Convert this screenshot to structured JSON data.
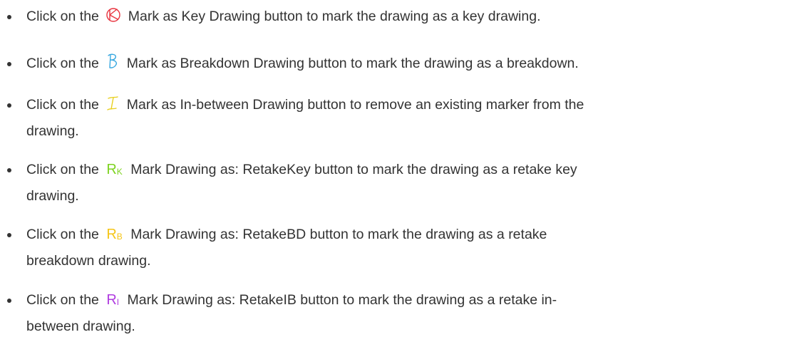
{
  "items": [
    {
      "prefix": "Click on the",
      "icon_name": "key-drawing-icon",
      "icon_color": "#e8343f",
      "suffix": "Mark as Key Drawing button to mark the drawing as a key drawing."
    },
    {
      "prefix": "Click on the",
      "icon_name": "breakdown-drawing-icon",
      "icon_color": "#38a8e0",
      "suffix": "Mark as Breakdown Drawing button to mark the drawing as a breakdown."
    },
    {
      "prefix": "Click on the",
      "icon_name": "inbetween-drawing-icon",
      "icon_color": "#e8d020",
      "suffix": "Mark as In-between Drawing button to remove an existing marker from the",
      "suffix2": "drawing."
    },
    {
      "prefix": "Click on the",
      "icon_name": "retake-key-icon",
      "icon_color": "#7ed321",
      "icon_letter": "R",
      "icon_sub": "K",
      "suffix": "Mark Drawing as: RetakeKey button to mark the drawing as a retake key",
      "suffix2": "drawing."
    },
    {
      "prefix": "Click on the",
      "icon_name": "retake-breakdown-icon",
      "icon_color": "#f5c518",
      "icon_letter": "R",
      "icon_sub": "B",
      "suffix": "Mark Drawing as: RetakeBD button to mark the drawing as a retake",
      "suffix2": "breakdown drawing."
    },
    {
      "prefix": "Click on the",
      "icon_name": "retake-inbetween-icon",
      "icon_color": "#b03ce0",
      "icon_letter": "R",
      "icon_sub": "I",
      "suffix": "Mark Drawing as: RetakeIB button to mark the drawing as a retake in-",
      "suffix2": "between drawing."
    }
  ]
}
